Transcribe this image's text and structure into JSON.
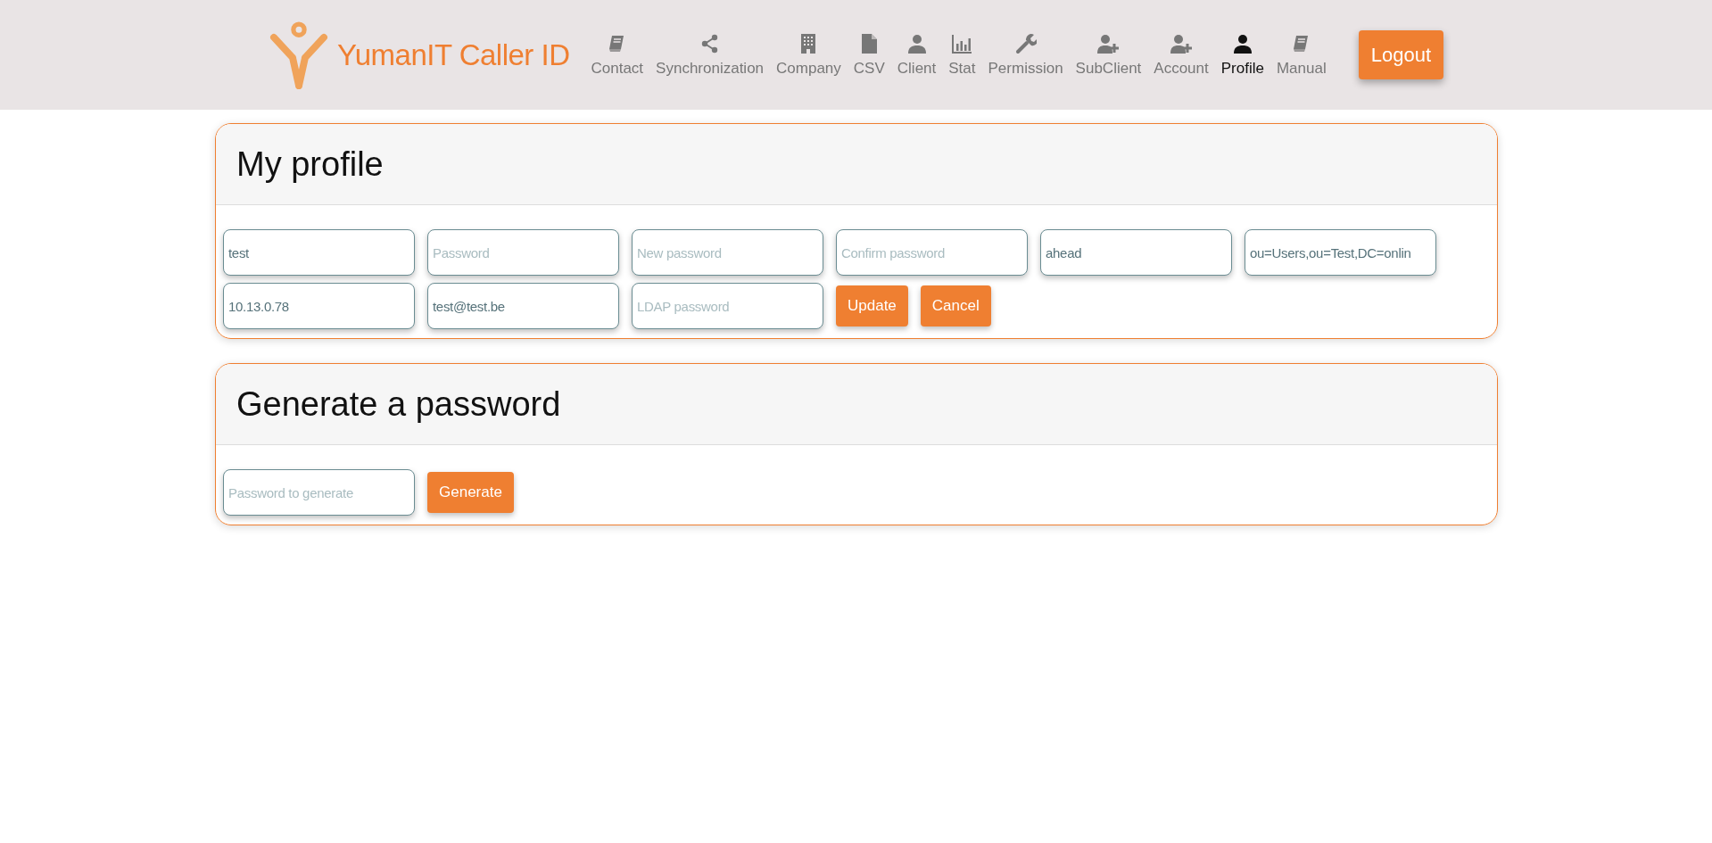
{
  "brand": {
    "name": "YumanIT Caller ID"
  },
  "nav": [
    {
      "label": "Contact",
      "kind": "book",
      "selected": false
    },
    {
      "label": "Synchronization",
      "kind": "share",
      "selected": false
    },
    {
      "label": "Company",
      "kind": "building",
      "selected": false
    },
    {
      "label": "CSV",
      "kind": "file",
      "selected": false
    },
    {
      "label": "Client",
      "kind": "user",
      "selected": false
    },
    {
      "label": "Stat",
      "kind": "chart",
      "selected": false
    },
    {
      "label": "Permission",
      "kind": "wrench",
      "selected": false
    },
    {
      "label": "SubClient",
      "kind": "user-plus",
      "selected": false
    },
    {
      "label": "Account",
      "kind": "user-plus",
      "selected": false
    },
    {
      "label": "Profile",
      "kind": "user",
      "selected": true
    },
    {
      "label": "Manual",
      "kind": "book",
      "selected": false
    }
  ],
  "logout": {
    "label": "Logout"
  },
  "cards": [
    {
      "title": "My profile",
      "items": [
        {
          "kind": "field",
          "value": "test"
        },
        {
          "kind": "field",
          "placeholder": "Password"
        },
        {
          "kind": "field",
          "placeholder": "New password"
        },
        {
          "kind": "field",
          "placeholder": "Confirm password"
        },
        {
          "kind": "field",
          "value": "ahead"
        },
        {
          "kind": "field",
          "value": "ou=Users,ou=Test,DC=onlin"
        },
        {
          "kind": "field",
          "value": "10.13.0.78"
        },
        {
          "kind": "field",
          "value": "test@test.be"
        },
        {
          "kind": "field",
          "placeholder": "LDAP password"
        },
        {
          "kind": "button",
          "label": "Update"
        },
        {
          "kind": "button",
          "label": "Cancel"
        }
      ]
    },
    {
      "title": "Generate a password",
      "items": [
        {
          "kind": "field",
          "placeholder": "Password to generate"
        },
        {
          "kind": "button",
          "label": "Generate"
        }
      ]
    }
  ]
}
